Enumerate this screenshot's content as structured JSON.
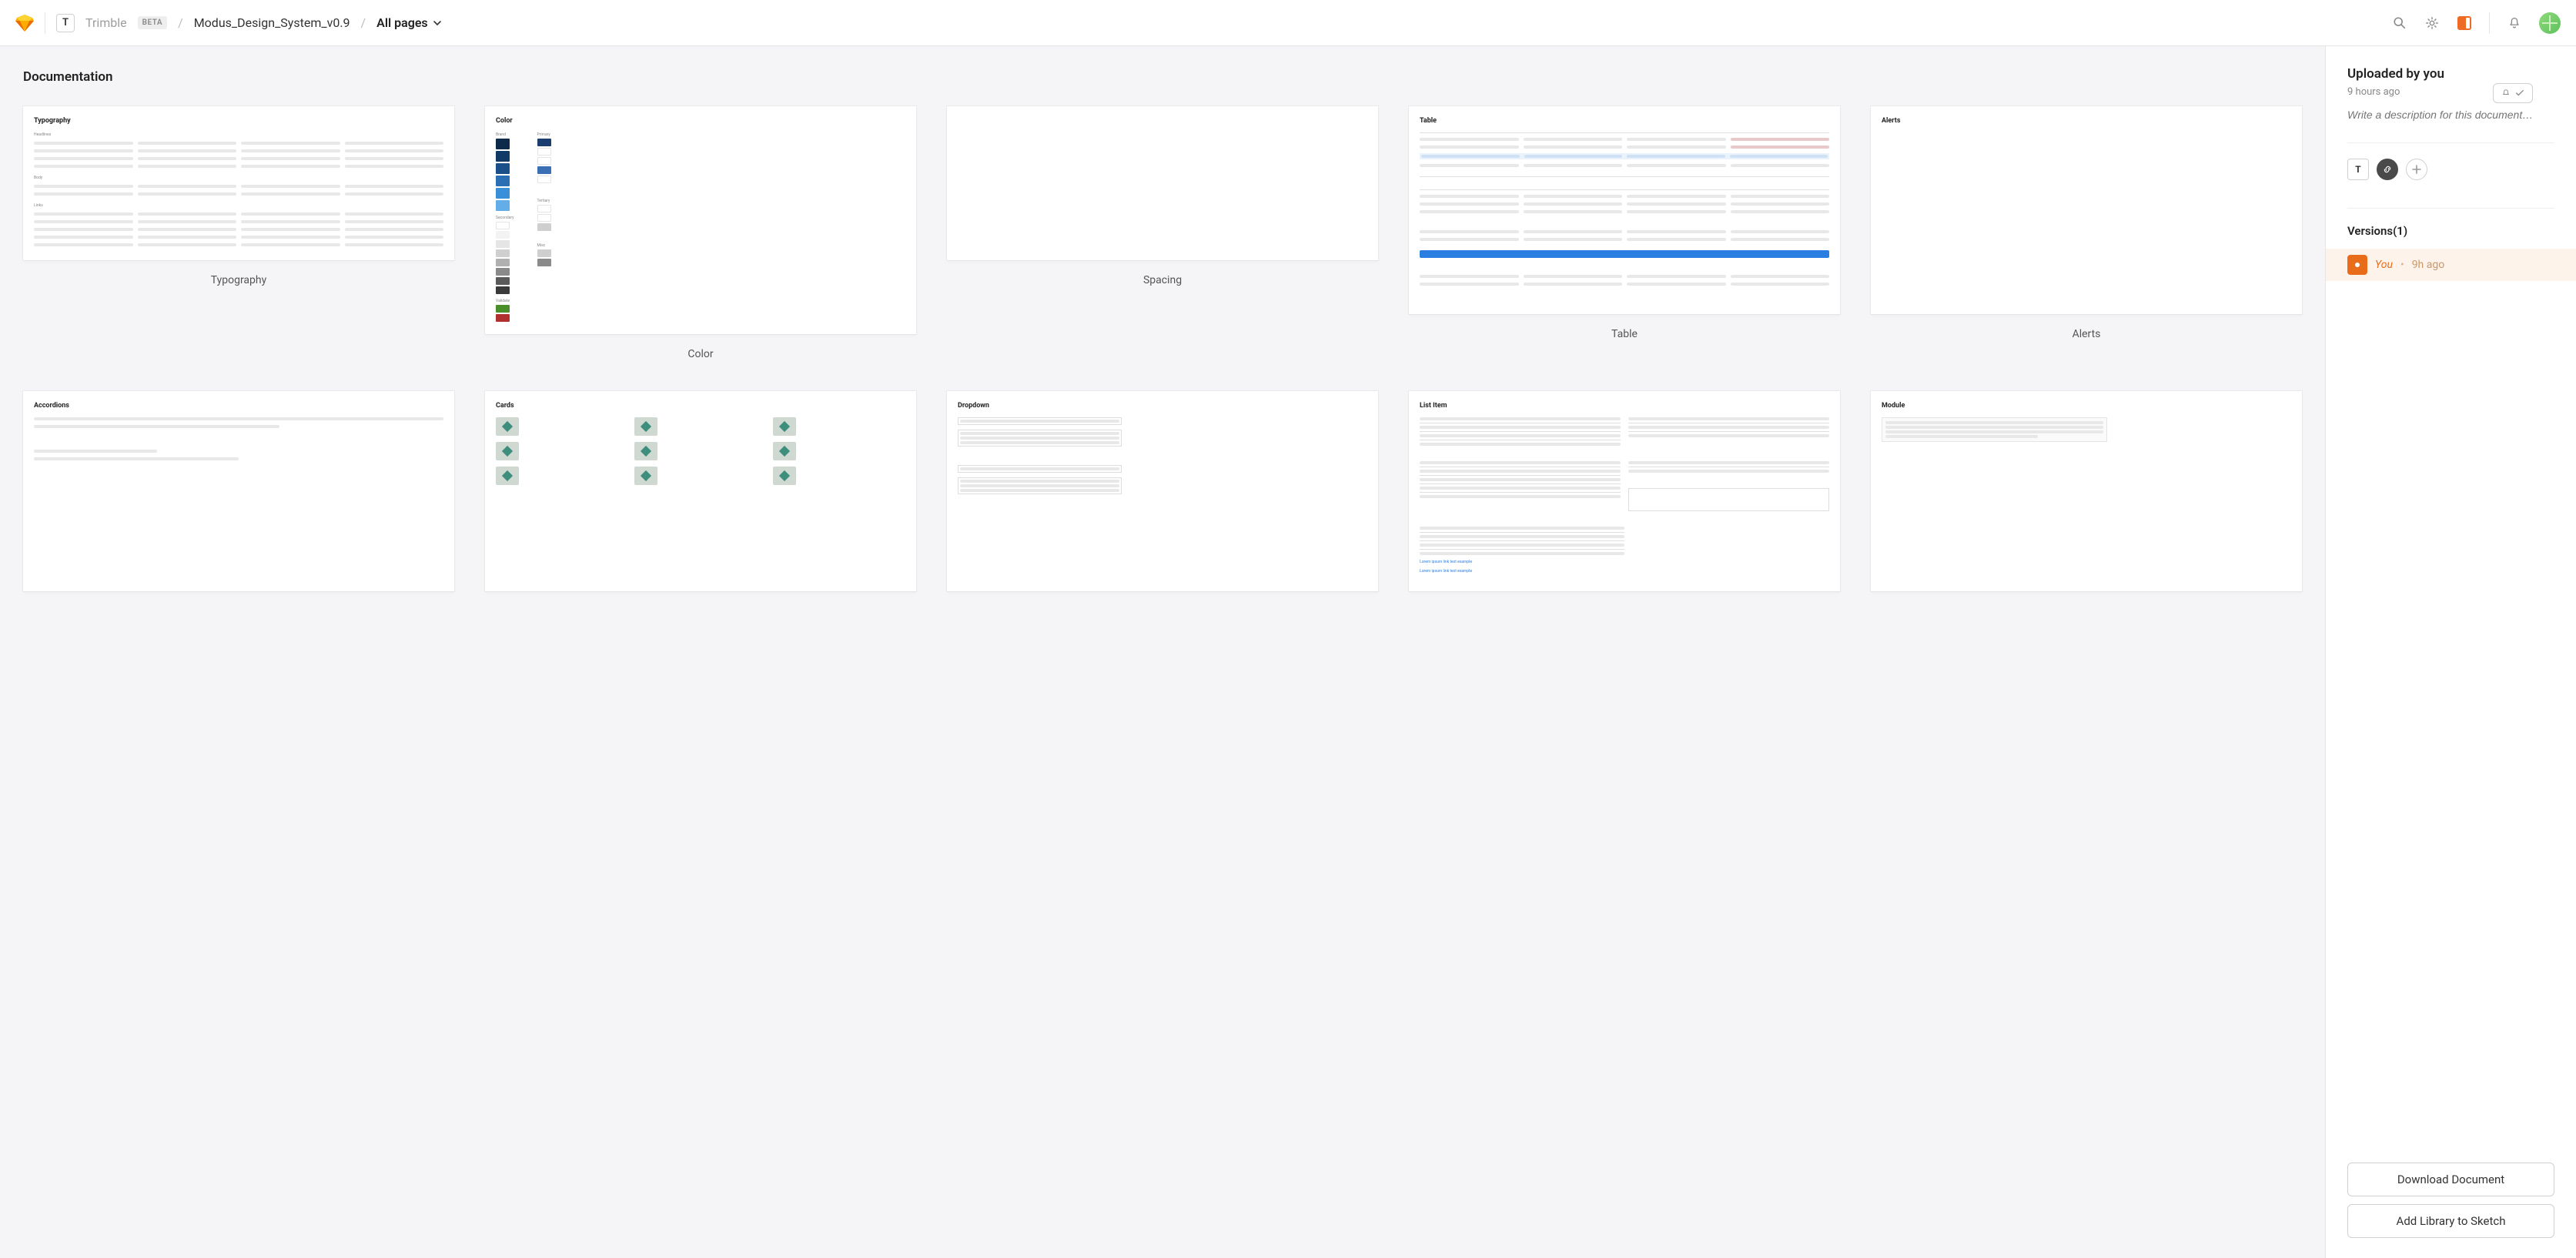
{
  "header": {
    "workspace_letter": "T",
    "workspace_name": "Trimble",
    "beta_label": "BETA",
    "doc_name": "Modus_Design_System_v0.9",
    "pages_label": "All pages"
  },
  "canvas": {
    "section_title": "Documentation",
    "artboards": [
      {
        "label": "Typography",
        "title": "Typography",
        "size": "med",
        "kind": "typography"
      },
      {
        "label": "Color",
        "title": "Color",
        "size": "tall",
        "kind": "color"
      },
      {
        "label": "Spacing",
        "title": "",
        "size": "med",
        "kind": "blank"
      },
      {
        "label": "Table",
        "title": "Table",
        "size": "tall",
        "kind": "table"
      },
      {
        "label": "Alerts",
        "title": "Alerts",
        "size": "tall",
        "kind": "blank-titled"
      },
      {
        "label": "",
        "title": "Accordions",
        "size": "short",
        "kind": "accordions"
      },
      {
        "label": "",
        "title": "Cards",
        "size": "short",
        "kind": "cards"
      },
      {
        "label": "",
        "title": "Dropdown",
        "size": "short",
        "kind": "dropdown"
      },
      {
        "label": "",
        "title": "List Item",
        "size": "short",
        "kind": "listitem"
      },
      {
        "label": "",
        "title": "Module",
        "size": "short",
        "kind": "module"
      }
    ]
  },
  "sidebar": {
    "uploaded_heading": "Uploaded by you",
    "uploaded_time": "9 hours ago",
    "description_placeholder": "Write a description for this document…",
    "chip_letter": "T",
    "versions_label": "Versions",
    "versions_count": "(1)",
    "version_you": "You",
    "version_sep": "•",
    "version_time": "9h ago",
    "download_label": "Download Document",
    "add_library_label": "Add Library to Sketch"
  }
}
